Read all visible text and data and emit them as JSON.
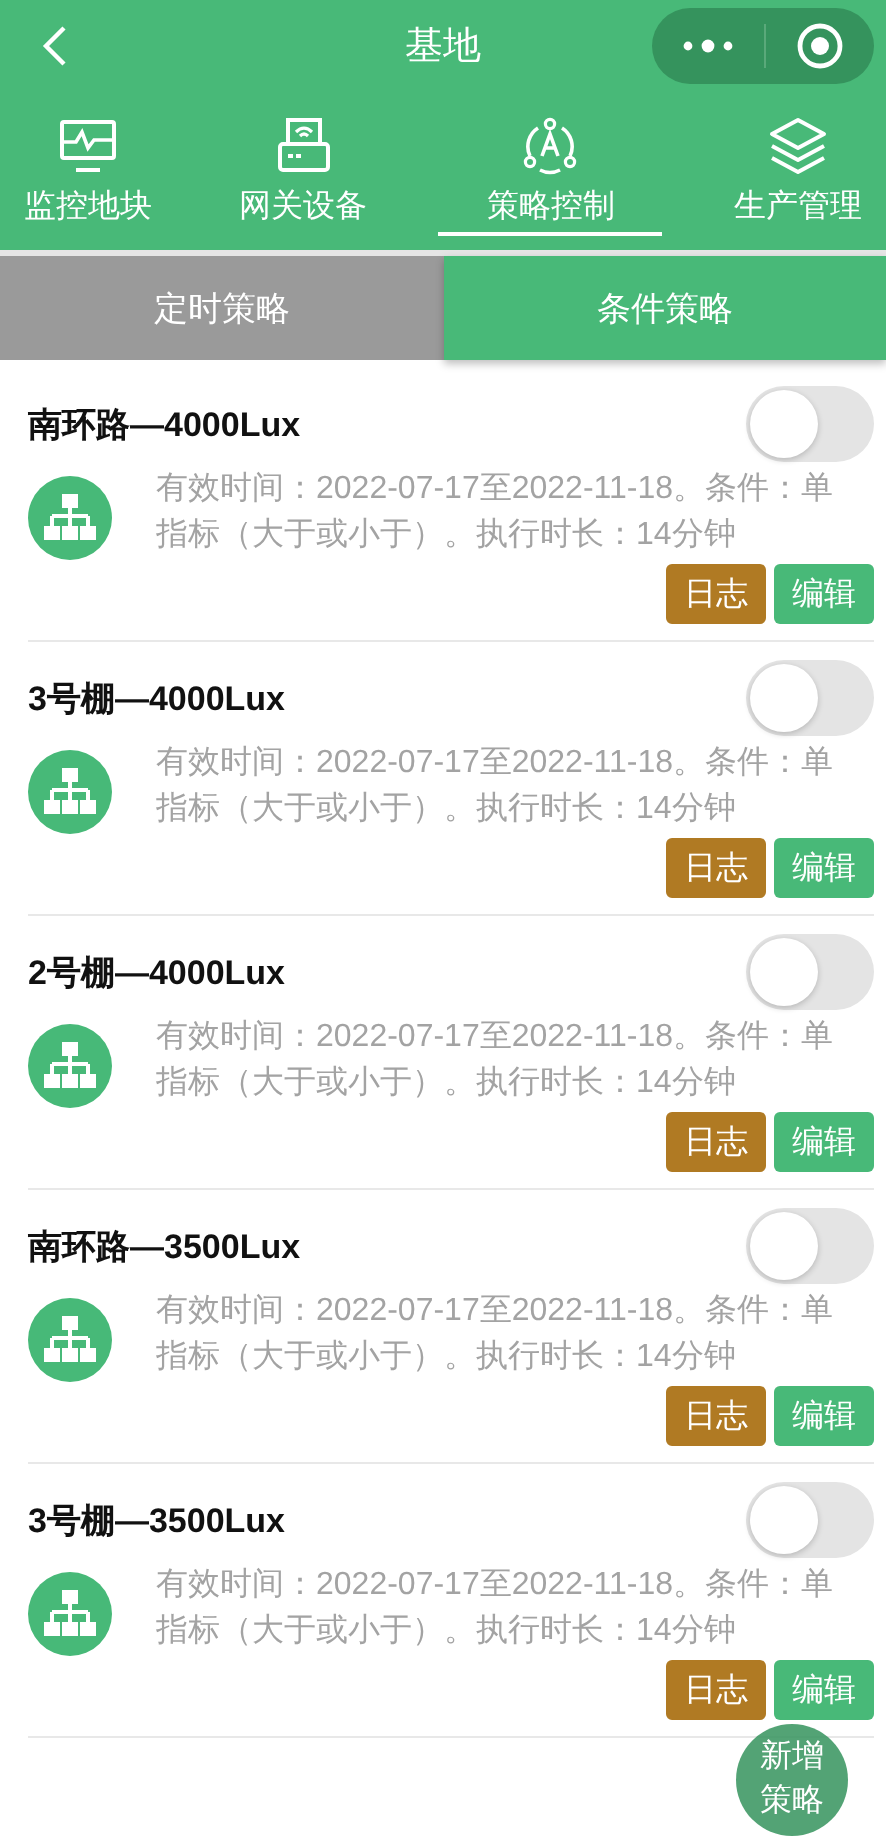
{
  "header": {
    "title": "基地"
  },
  "nav_tabs": [
    {
      "label": "监控地块",
      "kind": "monitor",
      "selected": false
    },
    {
      "label": "网关设备",
      "kind": "gateway",
      "selected": false
    },
    {
      "label": "策略控制",
      "kind": "strategy",
      "selected": true
    },
    {
      "label": "生产管理",
      "kind": "layers",
      "selected": false
    }
  ],
  "sub_tabs": [
    {
      "label": "定时策略",
      "selected": false
    },
    {
      "label": "条件策略",
      "selected": true
    }
  ],
  "strategies": [
    {
      "name": "南环路—4000Lux",
      "on": false,
      "description": "有效时间：2022-07-17至2022-11-18。条件：单指标（大于或小于）。执行时长：14分钟",
      "log_button": "日志",
      "edit_button": "编辑"
    },
    {
      "name": "3号棚—4000Lux",
      "on": false,
      "description": "有效时间：2022-07-17至2022-11-18。条件：单指标（大于或小于）。执行时长：14分钟",
      "log_button": "日志",
      "edit_button": "编辑"
    },
    {
      "name": "2号棚—4000Lux",
      "on": false,
      "description": "有效时间：2022-07-17至2022-11-18。条件：单指标（大于或小于）。执行时长：14分钟",
      "log_button": "日志",
      "edit_button": "编辑"
    },
    {
      "name": "南环路—3500Lux",
      "on": false,
      "description": "有效时间：2022-07-17至2022-11-18。条件：单指标（大于或小于）。执行时长：14分钟",
      "log_button": "日志",
      "edit_button": "编辑"
    },
    {
      "name": "3号棚—3500Lux",
      "on": false,
      "description": "有效时间：2022-07-17至2022-11-18。条件：单指标（大于或小于）。执行时长：14分钟",
      "log_button": "日志",
      "edit_button": "编辑"
    }
  ],
  "fab": {
    "label": "新增策略"
  }
}
